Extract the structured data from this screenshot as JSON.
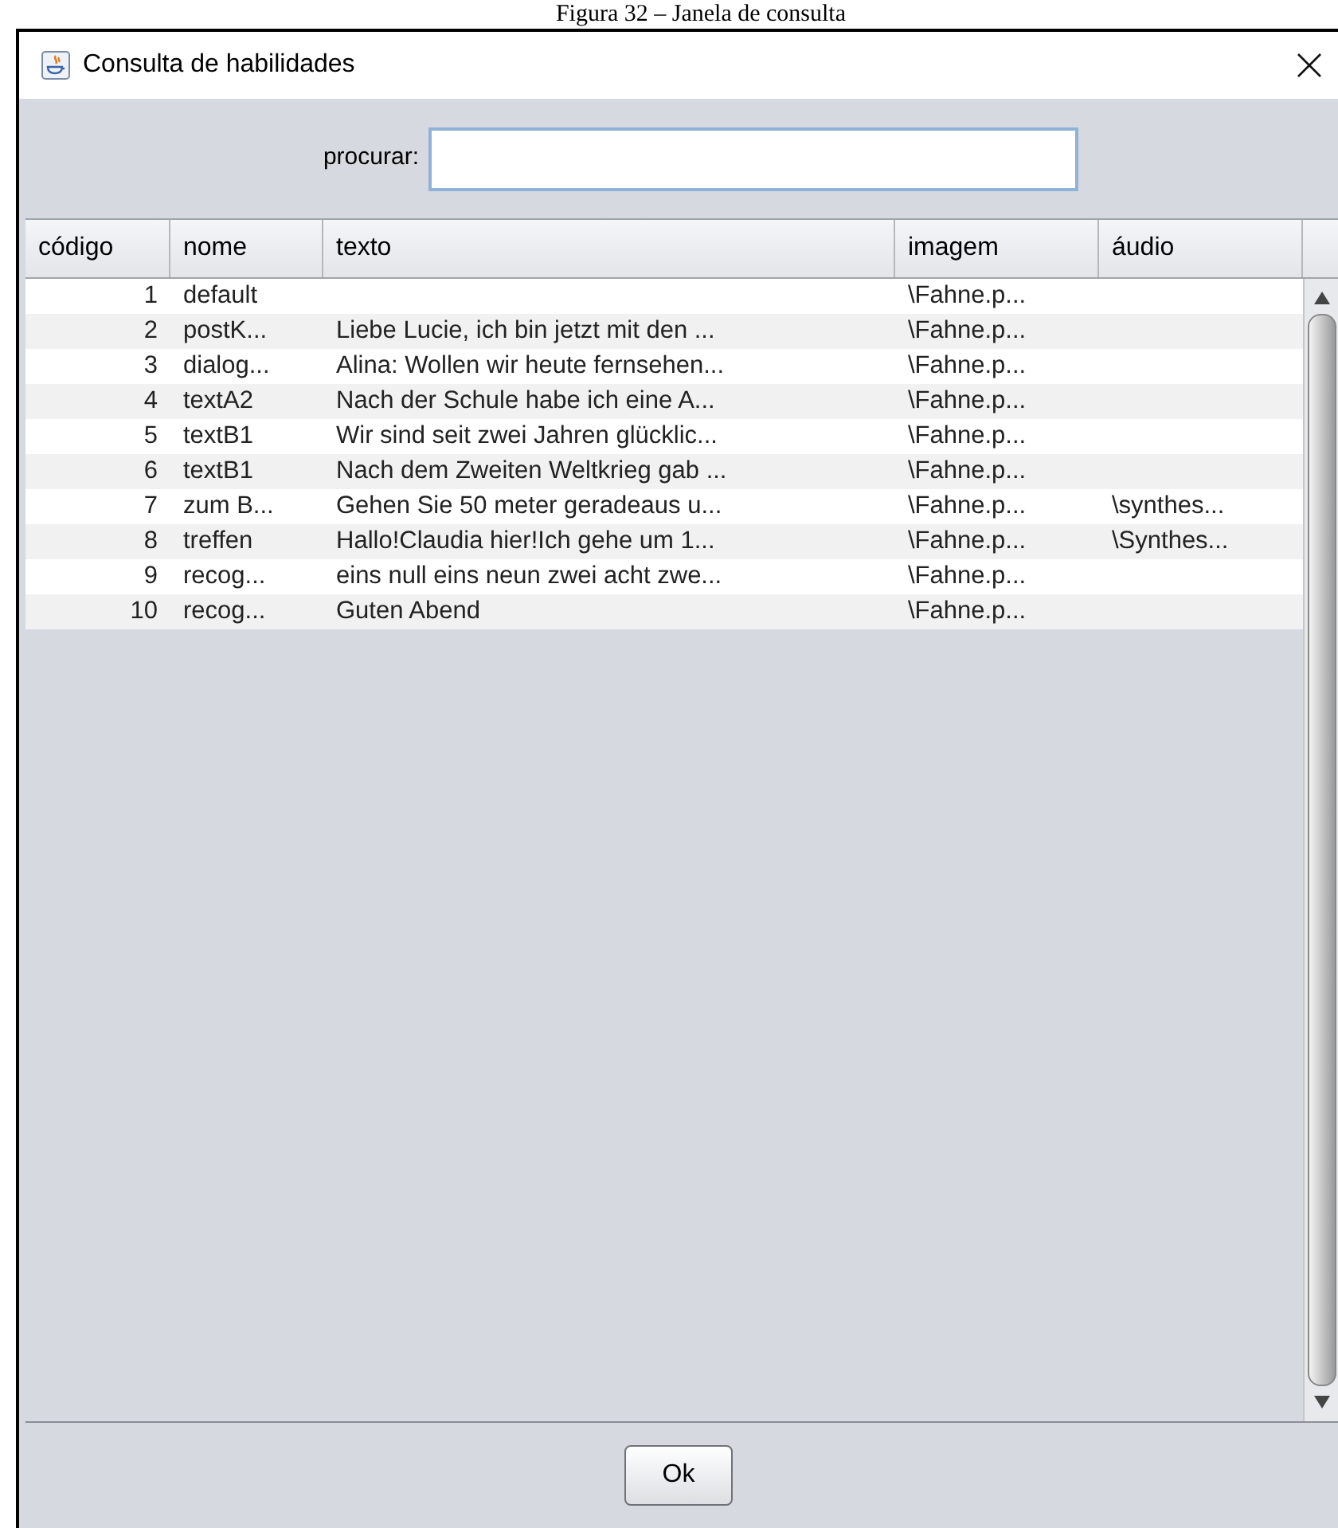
{
  "caption": "Figura 32 – Janela de consulta",
  "window": {
    "title": "Consulta de habilidades"
  },
  "search": {
    "label": "procurar:"
  },
  "table": {
    "columns": [
      "código",
      "nome",
      "texto",
      "imagem",
      "áudio"
    ],
    "rows": [
      {
        "cells": [
          "1",
          "default",
          null,
          "\\Fahne.p...",
          null
        ]
      },
      {
        "cells": [
          "2",
          "postK...",
          "Liebe Lucie, ich bin jetzt mit den ...",
          "\\Fahne.p...",
          null
        ]
      },
      {
        "cells": [
          "3",
          "dialog...",
          "Alina: Wollen wir heute fernsehen...",
          "\\Fahne.p...",
          null
        ]
      },
      {
        "cells": [
          "4",
          "textA2",
          "Nach der Schule habe ich eine A...",
          "\\Fahne.p...",
          null
        ]
      },
      {
        "cells": [
          "5",
          "textB1",
          "Wir sind seit zwei Jahren glücklic...",
          "\\Fahne.p...",
          null
        ]
      },
      {
        "cells": [
          "6",
          "textB1",
          "Nach dem Zweiten Weltkrieg gab ...",
          "\\Fahne.p...",
          null
        ]
      },
      {
        "cells": [
          "7",
          "zum B...",
          "Gehen Sie 50 meter geradeaus u...",
          "\\Fahne.p...",
          "\\synthes..."
        ]
      },
      {
        "cells": [
          "8",
          "treffen",
          "Hallo!Claudia hier!Ich gehe um 1...",
          "\\Fahne.p...",
          "\\Synthes..."
        ]
      },
      {
        "cells": [
          "9",
          "recog...",
          "eins null eins neun zwei acht zwe...",
          "\\Fahne.p...",
          null
        ]
      },
      {
        "cells": [
          "10",
          "recog...",
          "Guten Abend",
          "\\Fahne.p...",
          null
        ]
      }
    ]
  },
  "buttons": [
    "Ok"
  ]
}
